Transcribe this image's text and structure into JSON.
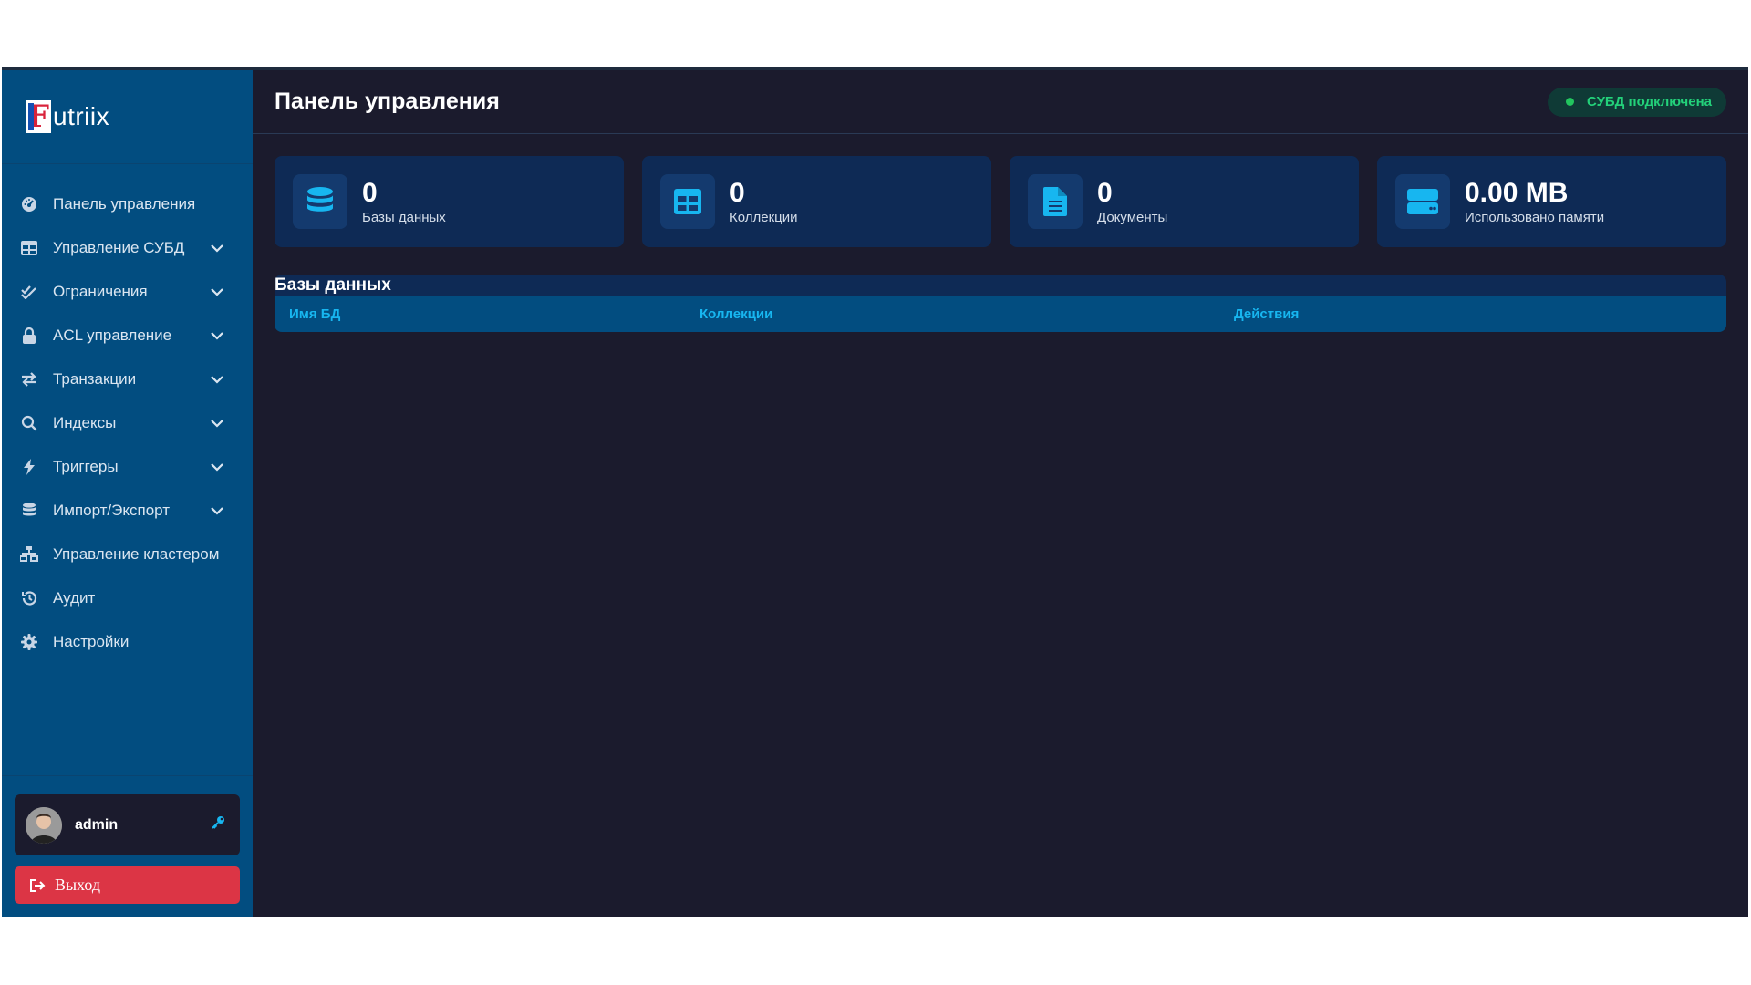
{
  "app": {
    "logo_text": "utriix",
    "logo_letter": "F"
  },
  "sidebar": {
    "items": [
      {
        "label": "Панель управления",
        "icon": "dashboard-icon",
        "expandable": false
      },
      {
        "label": "Управление СУБД",
        "icon": "table-icon",
        "expandable": true
      },
      {
        "label": "Ограничения",
        "icon": "check-double-icon",
        "expandable": true
      },
      {
        "label": "ACL управление",
        "icon": "lock-icon",
        "expandable": true
      },
      {
        "label": "Транзакции",
        "icon": "exchange-icon",
        "expandable": true
      },
      {
        "label": "Индексы",
        "icon": "search-icon",
        "expandable": true
      },
      {
        "label": "Триггеры",
        "icon": "bolt-icon",
        "expandable": true
      },
      {
        "label": "Импорт/Экспорт",
        "icon": "database-icon",
        "expandable": true
      },
      {
        "label": "Управление кластером",
        "icon": "sitemap-icon",
        "expandable": false
      },
      {
        "label": "Аудит",
        "icon": "history-icon",
        "expandable": false
      },
      {
        "label": "Настройки",
        "icon": "gear-icon",
        "expandable": false
      }
    ],
    "user": {
      "name": "admin",
      "role_icon": "key-icon"
    },
    "logout_label": "Выход"
  },
  "header": {
    "title": "Панель управления",
    "status": "СУБД подключена"
  },
  "stats": [
    {
      "value": "0",
      "label": "Базы данных",
      "icon": "database-icon"
    },
    {
      "value": "0",
      "label": "Коллекции",
      "icon": "table-icon"
    },
    {
      "value": "0",
      "label": "Документы",
      "icon": "file-icon"
    },
    {
      "value": "0.00 MB",
      "label": "Использовано памяти",
      "icon": "hdd-icon"
    }
  ],
  "databases": {
    "title": "Базы данных",
    "columns": [
      "Имя БД",
      "Коллекции",
      "Действия"
    ],
    "rows": []
  },
  "colors": {
    "sidebar": "#024d80",
    "background": "#1b1b2d",
    "card": "#0e2a55",
    "accent": "#17b6f0",
    "success": "#22c55e",
    "danger": "#dc3545"
  }
}
